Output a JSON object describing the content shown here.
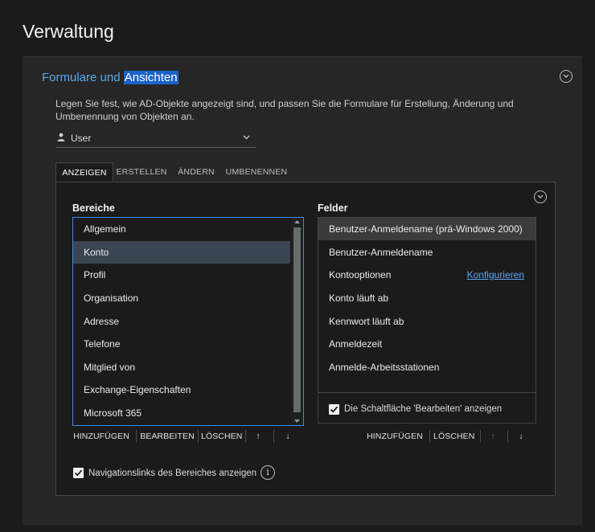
{
  "page": {
    "title": "Verwaltung"
  },
  "card": {
    "title_prefix": "Formulare und ",
    "title_highlight": "Ansichten",
    "description": "Legen Sie fest, wie AD-Objekte angezeigt sind, und passen Sie die Formulare für Erstellung, Änderung und Umbenennung von Objekten an.",
    "object_select": {
      "icon": "user-icon",
      "value": "User"
    }
  },
  "tabs": [
    {
      "label": "ANZEIGEN",
      "active": true
    },
    {
      "label": "ERSTELLEN",
      "active": false
    },
    {
      "label": "ÄNDERN",
      "active": false
    },
    {
      "label": "UMBENENNEN",
      "active": false
    }
  ],
  "areas": {
    "label": "Bereiche",
    "items": [
      "Allgemein",
      "Konto",
      "Profil",
      "Organisation",
      "Adresse",
      "Telefone",
      "Mitglied von",
      "Exchange-Eigenschaften",
      "Microsoft 365"
    ],
    "selected": "Konto",
    "buttons": {
      "add": "HINZUFÜGEN",
      "edit": "BEARBEITEN",
      "delete": "LÖSCHEN",
      "up": "↑",
      "down": "↓"
    },
    "nav_links_checkbox": {
      "label": "Navigationslinks des Bereiches anzeigen",
      "checked": true
    }
  },
  "fields": {
    "label": "Felder",
    "items": [
      "Benutzer-Anmeldename (prä-Windows 2000)",
      "Benutzer-Anmeldename",
      "Kontooptionen",
      "Konto läuft ab",
      "Kennwort läuft ab",
      "Anmeldezeit",
      "Anmelde-Arbeitsstationen"
    ],
    "selected": "Benutzer-Anmeldename (prä-Windows 2000)",
    "configure_link": "Konfigurieren",
    "edit_button_checkbox": {
      "label": "Die Schaltfläche 'Bearbeiten' anzeigen",
      "checked": true
    },
    "buttons": {
      "add": "HINZUFÜGEN",
      "delete": "LÖSCHEN",
      "up": "↑",
      "down": "↓"
    }
  },
  "info_glyph": "i",
  "colors": {
    "accent": "#5aa7f2",
    "focus_border": "#3a8ee6",
    "selection": "#1a63c9"
  }
}
